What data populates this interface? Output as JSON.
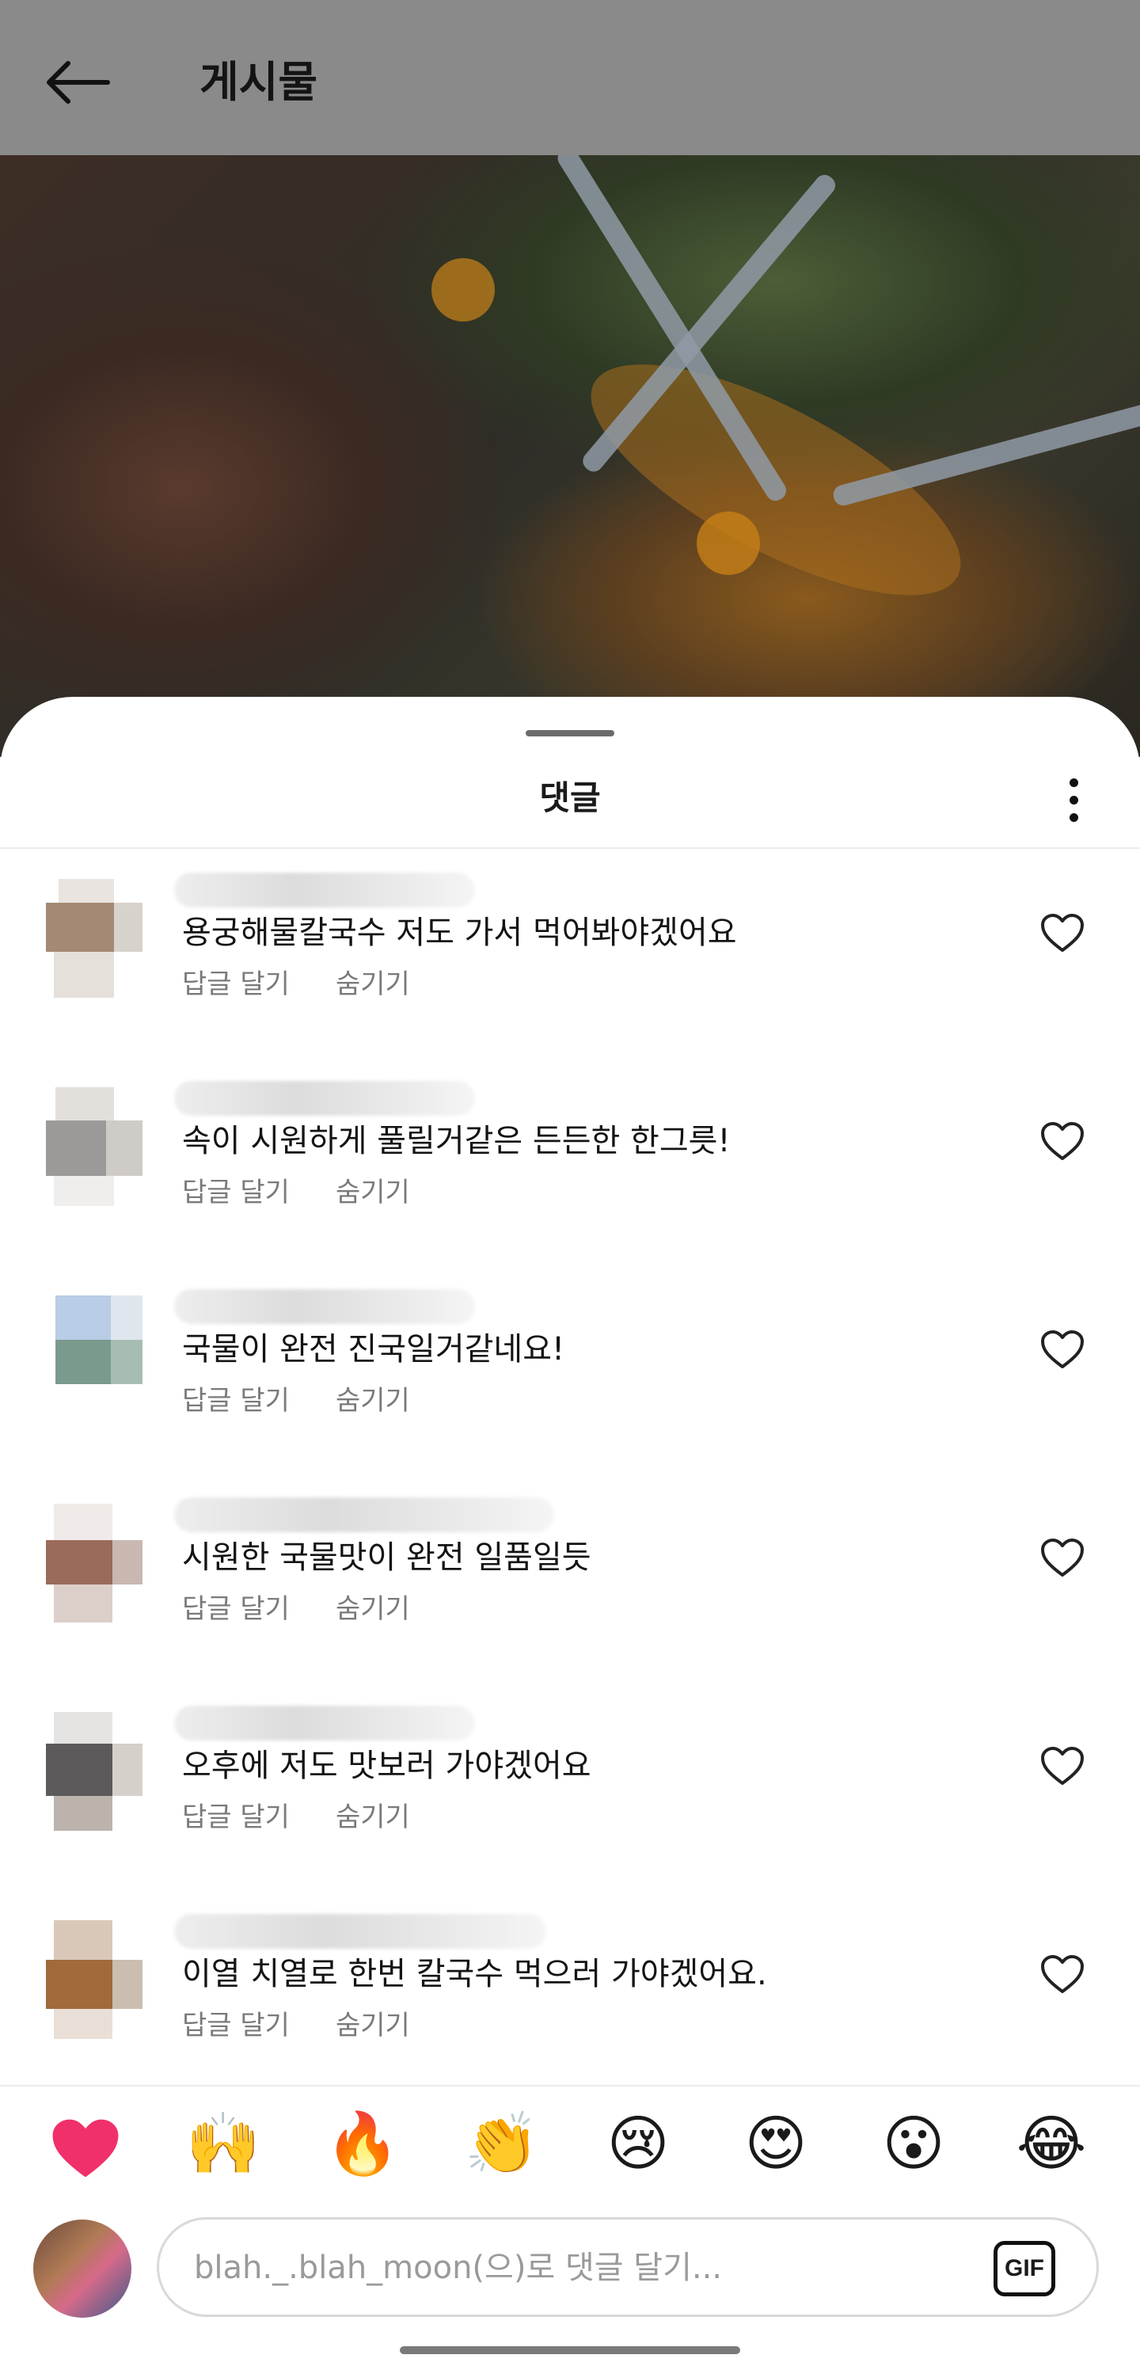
{
  "header": {
    "title": "게시물"
  },
  "sheet": {
    "title": "댓글"
  },
  "comments": [
    {
      "text": "용궁해물칼국수 저도 가서 먹어봐야겠어요",
      "reply": "답글 달기",
      "hide": "숨기기"
    },
    {
      "text": "속이 시원하게 풀릴거같은 든든한 한그릇!",
      "reply": "답글 달기",
      "hide": "숨기기"
    },
    {
      "text": "국물이 완전 진국일거같네요!",
      "reply": "답글 달기",
      "hide": "숨기기"
    },
    {
      "text": "시원한 국물맛이 완전 일품일듯",
      "reply": "답글 달기",
      "hide": "숨기기"
    },
    {
      "text": "오후에 저도 맛보러 가야겠어요",
      "reply": "답글 달기",
      "hide": "숨기기"
    },
    {
      "text": "이열 치열로 한번 칼국수 먹으러 가야겠어요.",
      "reply": "답글 달기",
      "hide": "숨기기"
    }
  ],
  "emoji_bar": {
    "emojis": [
      "❤",
      "🙌",
      "🔥",
      "👏",
      "😢",
      "😍",
      "😮",
      "😂"
    ],
    "icons": [
      "heart-emoji",
      "raised-hands-emoji",
      "fire-emoji",
      "clapping-hands-emoji",
      "crying-face-emoji",
      "heart-eyes-emoji",
      "surprised-face-emoji",
      "tears-of-joy-emoji"
    ]
  },
  "input": {
    "placeholder": "blah._.blah_moon(으)로 댓글 달기...",
    "gif_label": "GIF"
  },
  "colors": {
    "overlay": "#8a8a8a",
    "text": "#141414",
    "muted": "#7a7a7a",
    "heart": "#f0306a"
  }
}
